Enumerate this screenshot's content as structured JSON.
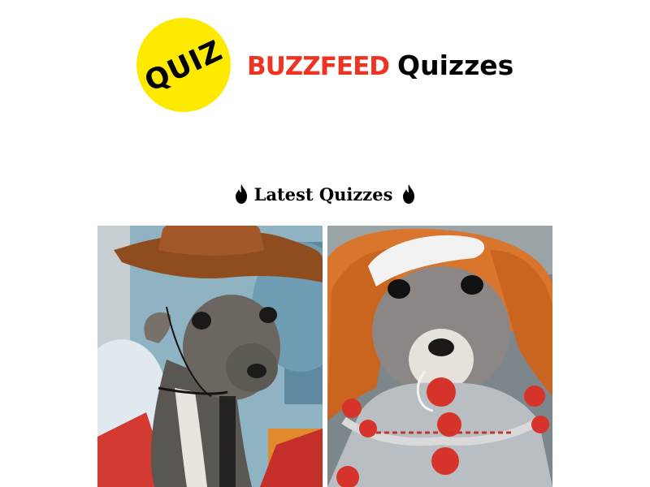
{
  "header": {
    "badge_text": "QUIZ",
    "brand_buzzfeed": "BuzzFeed",
    "brand_quizzes": "Quizzes",
    "colors": {
      "badge": "#fee900",
      "buzzfeed": "#ee3322",
      "text": "#000000"
    }
  },
  "section": {
    "title": "Latest Quizzes",
    "icon": "fire-icon"
  },
  "quizzes": [
    {
      "image": "dog-in-cowboy-hat-costume"
    },
    {
      "image": "chihuahua-in-clown-costume"
    }
  ]
}
